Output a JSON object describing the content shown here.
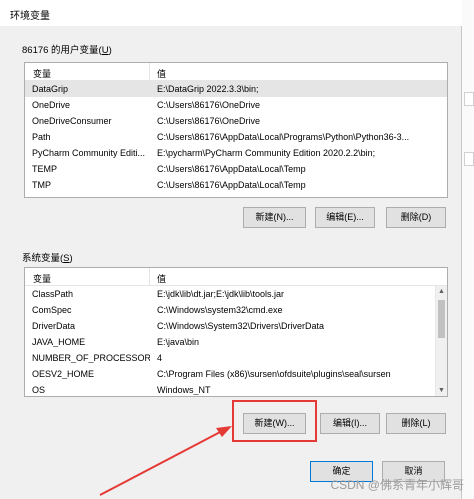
{
  "window": {
    "title": "环境变量"
  },
  "user_vars": {
    "label_prefix": "86176 的用户变量(",
    "label_hotkey": "U",
    "label_suffix": ")",
    "headers": {
      "name": "变量",
      "value": "值"
    },
    "rows": [
      {
        "name": "DataGrip",
        "value": "E:\\DataGrip 2022.3.3\\bin;"
      },
      {
        "name": "OneDrive",
        "value": "C:\\Users\\86176\\OneDrive"
      },
      {
        "name": "OneDriveConsumer",
        "value": "C:\\Users\\86176\\OneDrive"
      },
      {
        "name": "Path",
        "value": "C:\\Users\\86176\\AppData\\Local\\Programs\\Python\\Python36-3..."
      },
      {
        "name": "PyCharm Community Editi...",
        "value": "E:\\pycharm\\PyCharm Community Edition 2020.2.2\\bin;"
      },
      {
        "name": "TEMP",
        "value": "C:\\Users\\86176\\AppData\\Local\\Temp"
      },
      {
        "name": "TMP",
        "value": "C:\\Users\\86176\\AppData\\Local\\Temp"
      }
    ],
    "buttons": {
      "new": "新建(N)...",
      "edit": "编辑(E)...",
      "delete": "删除(D)"
    }
  },
  "system_vars": {
    "label_prefix": "系统变量(",
    "label_hotkey": "S",
    "label_suffix": ")",
    "headers": {
      "name": "变量",
      "value": "值"
    },
    "rows": [
      {
        "name": "ClassPath",
        "value": "E:\\jdk\\lib\\dt.jar;E:\\jdk\\lib\\tools.jar"
      },
      {
        "name": "ComSpec",
        "value": "C:\\Windows\\system32\\cmd.exe"
      },
      {
        "name": "DriverData",
        "value": "C:\\Windows\\System32\\Drivers\\DriverData"
      },
      {
        "name": "JAVA_HOME",
        "value": "E:\\java\\bin"
      },
      {
        "name": "NUMBER_OF_PROCESSORS",
        "value": "4"
      },
      {
        "name": "OESV2_HOME",
        "value": "C:\\Program Files (x86)\\sursen\\ofdsuite\\plugins\\seal\\sursen"
      },
      {
        "name": "OS",
        "value": "Windows_NT"
      }
    ],
    "buttons": {
      "new": "新建(W)...",
      "edit": "编辑(I)...",
      "delete": "删除(L)"
    }
  },
  "footer": {
    "ok": "确定",
    "cancel": "取消"
  },
  "watermark": "CSDN @佛系青年小辉哥",
  "annotation_color": "#e53935"
}
